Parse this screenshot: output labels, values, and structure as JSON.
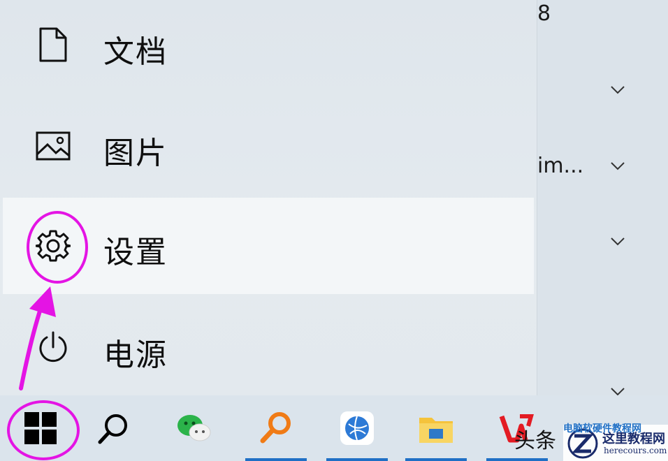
{
  "menu": {
    "items": [
      {
        "label": "文档",
        "icon": "document-icon"
      },
      {
        "label": "图片",
        "icon": "picture-icon"
      },
      {
        "label": "设置",
        "icon": "gear-icon"
      },
      {
        "label": "电源",
        "icon": "power-icon"
      }
    ]
  },
  "right_panel": {
    "text_top": "8",
    "text_mid": "im..."
  },
  "taskbar": {
    "buttons": [
      "start-button",
      "search-button",
      "wechat-button",
      "search-app-button",
      "browser-button",
      "file-explorer-button",
      "wps-button"
    ]
  },
  "watermark": {
    "top": "电脑软硬件教程网",
    "title": "这里教程网",
    "url": "herecours.com",
    "overlay_text": "头条"
  },
  "colors": {
    "annotation": "#e414e4",
    "taskbar_underline": "#1f6fc5"
  }
}
